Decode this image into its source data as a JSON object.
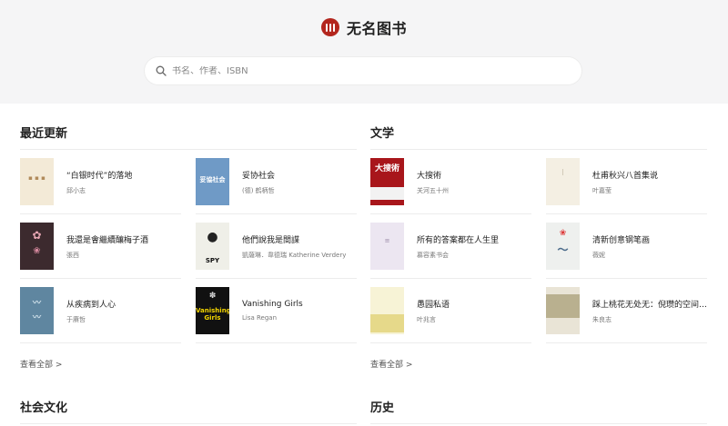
{
  "brand": {
    "name": "无名图书",
    "logo_icon": "book-logo-icon",
    "logo_color": "#b3261e"
  },
  "search": {
    "placeholder": "书名、作者、ISBN",
    "icon": "search-icon"
  },
  "sections": [
    {
      "title": "最近更新",
      "more_label": "查看全部 >",
      "books": [
        {
          "title": "“白银时代”的落地",
          "author": "邱小志",
          "cover_bg": "#f3ead7"
        },
        {
          "title": "妥协社会",
          "author": "(德) 鹤柄哲",
          "cover_bg": "#6f9ac6",
          "cover_text": "妥協社会"
        },
        {
          "title": "我還是會繼續釀梅子酒",
          "author": "張西",
          "cover_bg": "#3c2a2e"
        },
        {
          "title": "他們說我是間諜",
          "author": "凱薩琳．韋德瑞 Katherine Verdery",
          "cover_bg": "#efefe8",
          "cover_text": "SPY"
        },
        {
          "title": "从疾病到人心",
          "author": "于赓哲",
          "cover_bg": "#5f86a0"
        },
        {
          "title": "Vanishing Girls",
          "author": "Lisa Regan",
          "cover_bg": "#111111",
          "cover_text": "Vanishing Girls"
        }
      ]
    },
    {
      "title": "文学",
      "more_label": "查看全部 >",
      "books": [
        {
          "title": "大搜術",
          "author": "关河五十州",
          "cover_bg": "#a8161b",
          "cover_text": "大搜術"
        },
        {
          "title": "杜甫秋兴八首集说",
          "author": "叶嘉莹",
          "cover_bg": "#f4efe3"
        },
        {
          "title": "所有的答案都在人生里",
          "author": "慕容素书会",
          "cover_bg": "#ece6f1"
        },
        {
          "title": "清新创意钢笔画",
          "author": "薇妮",
          "cover_bg": "#eef0ee"
        },
        {
          "title": "愚园私语",
          "author": "叶兆言",
          "cover_bg": "#f7f3d6"
        },
        {
          "title": "踩上桃花无处无：倪瓒的空间…",
          "author": "朱良志",
          "cover_bg": "#e9e4d6"
        }
      ]
    },
    {
      "title": "社会文化"
    },
    {
      "title": "历史"
    }
  ]
}
